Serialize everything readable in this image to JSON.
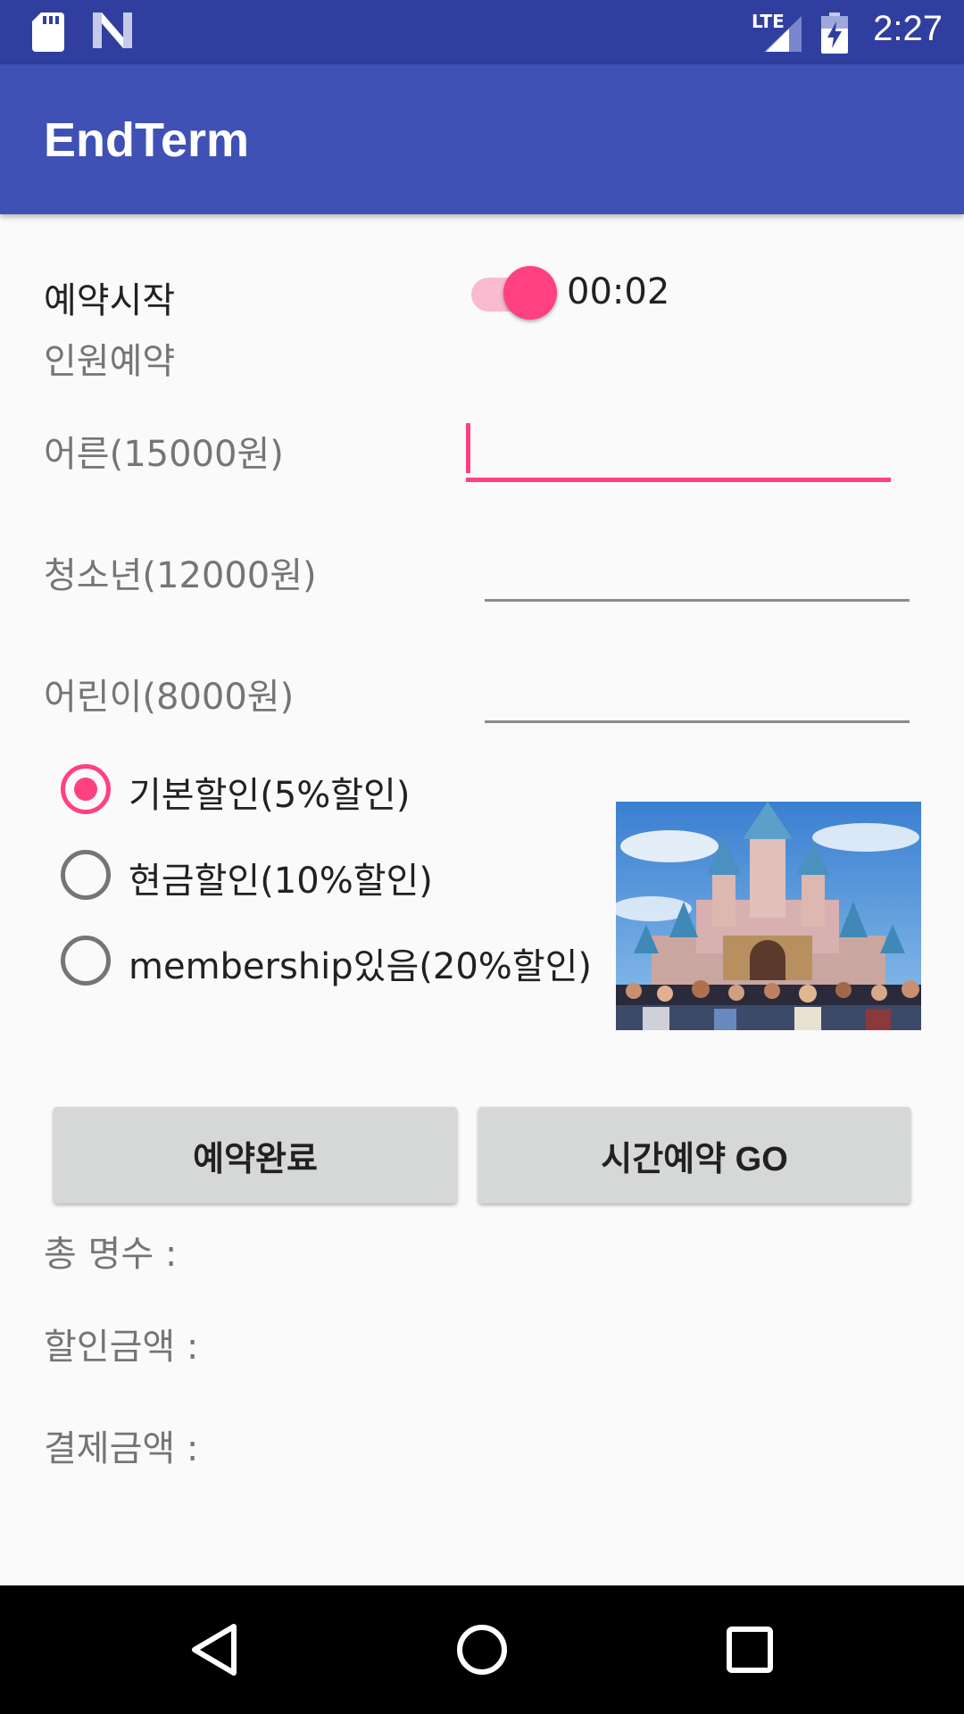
{
  "status_bar": {
    "time": "2:27",
    "network": "LTE",
    "icons": [
      "sd-card-icon",
      "n-logo-icon",
      "lte-signal-icon",
      "battery-charging-icon"
    ]
  },
  "app_bar": {
    "title": "EndTerm"
  },
  "reservation": {
    "start_label": "예약시작",
    "switch_on": true,
    "timer": "00:02",
    "section_label": "인원예약"
  },
  "people": {
    "adult_label": "어른(15000원)",
    "adult_value": "",
    "youth_label": "청소년(12000원)",
    "youth_value": "",
    "child_label": "어린이(8000원)",
    "child_value": ""
  },
  "discounts": [
    {
      "label": "기본할인(5%할인)",
      "checked": true
    },
    {
      "label": "현금할인(10%할인)",
      "checked": false
    },
    {
      "label": "membership있음(20%할인)",
      "checked": false
    }
  ],
  "image": {
    "subject": "castle-photo"
  },
  "buttons": {
    "complete": "예약완료",
    "time_reserve": "시간예약 GO"
  },
  "results": {
    "total_count": "총 명수 :",
    "discount_amount": "할인금액 :",
    "payment_amount": "결제금액 :"
  },
  "nav_bar": {
    "icons": [
      "back-icon",
      "home-icon",
      "recents-icon"
    ]
  },
  "colors": {
    "status_bar": "#303f9f",
    "app_bar": "#3f51b5",
    "accent": "#ff4081",
    "accent_light": "#f8bbd0",
    "background": "#fafafa",
    "button": "#d6d7d7"
  }
}
